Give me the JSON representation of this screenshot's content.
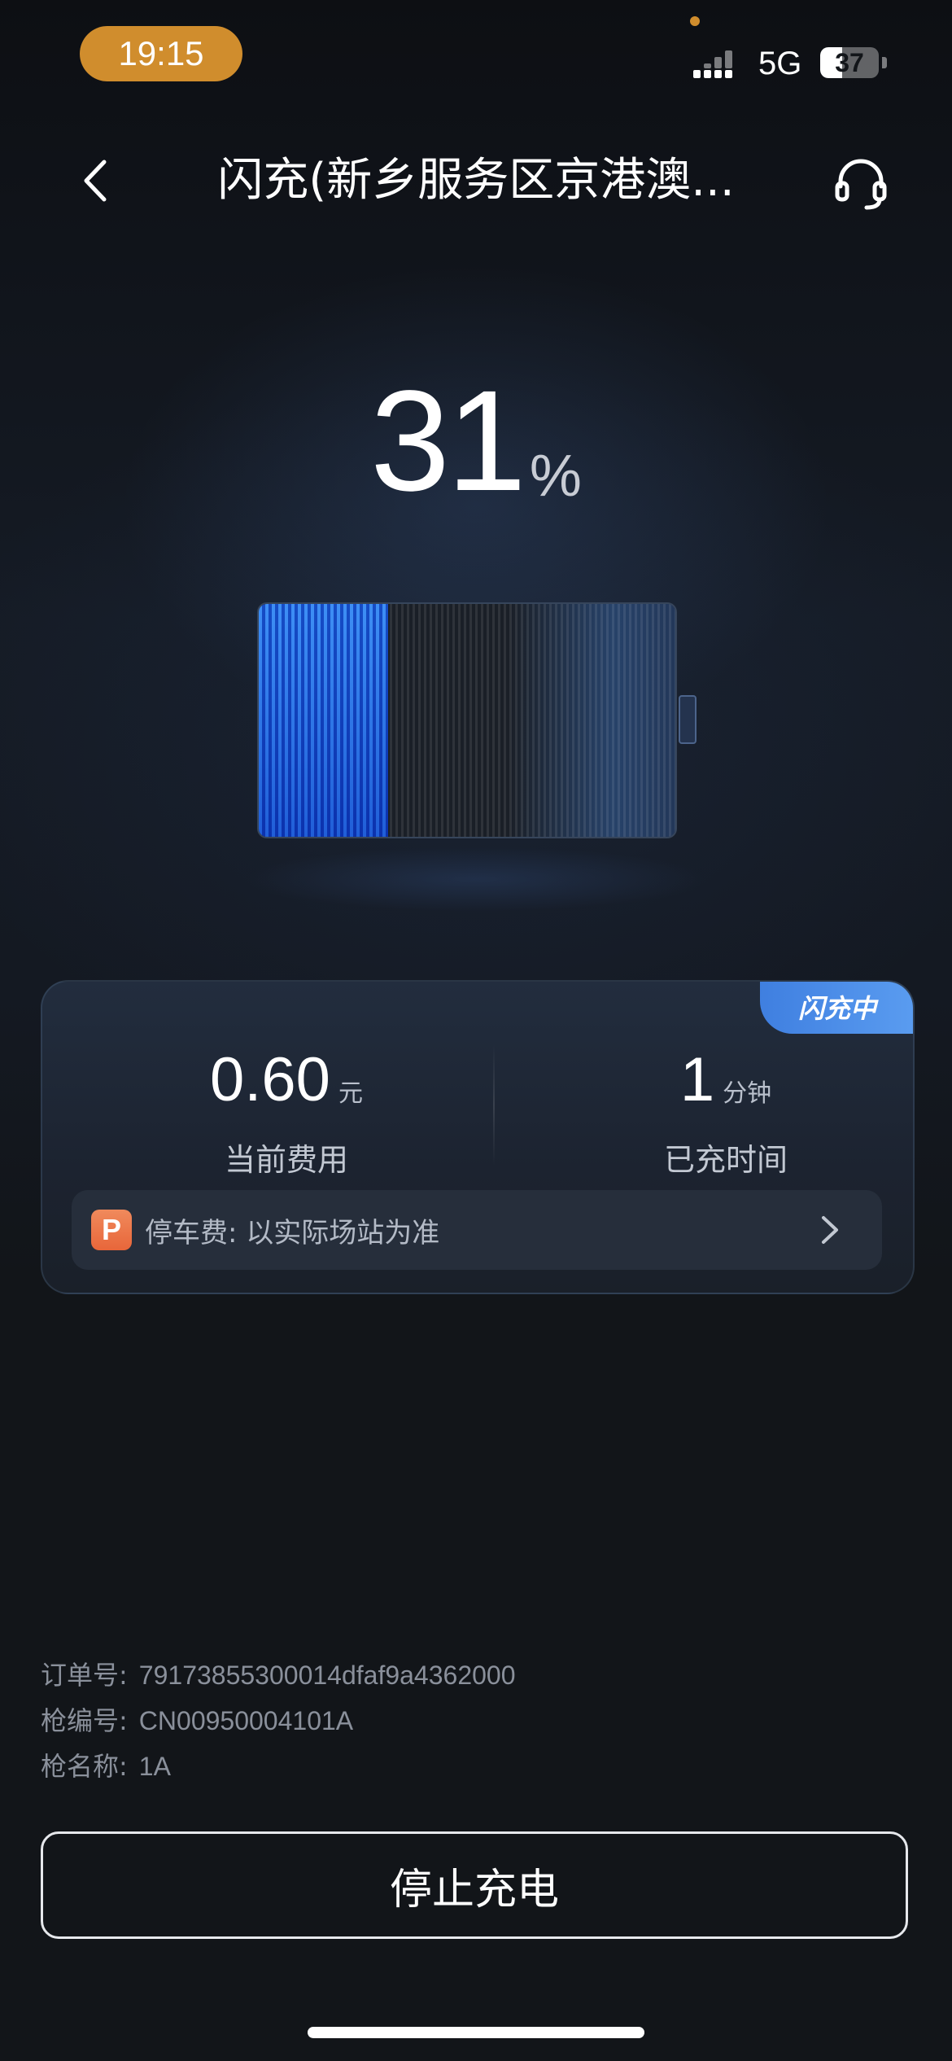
{
  "status_bar": {
    "time": "19:15",
    "network": "5G",
    "battery": "37",
    "battery_level": 0.37
  },
  "nav": {
    "title": "闪充(新乡服务区京港澳...",
    "back_icon": "chevron-left-icon",
    "support_icon": "headset-icon"
  },
  "charging": {
    "soc_value": "31",
    "soc_unit": "%",
    "soc_level": 0.31
  },
  "card": {
    "badge": "闪充中",
    "cost_value": "0.60",
    "cost_unit": "元",
    "cost_label": "当前费用",
    "time_value": "1",
    "time_unit": "分钟",
    "time_label": "已充时间",
    "parking_icon_text": "P",
    "parking_text": "停车费: 以实际场站为准"
  },
  "order": {
    "order_no_label": "订单号:",
    "order_no": "79173855300014dfaf9a4362000",
    "gun_no_label": "枪编号:",
    "gun_no": "CN00950004101A",
    "gun_name_label": "枪名称:",
    "gun_name": "1A"
  },
  "actions": {
    "stop_label": "停止充电"
  },
  "colors": {
    "accent_blue": "#3f7fe0",
    "status_orange": "#d08d2d",
    "parking_orange": "#e8663a"
  }
}
